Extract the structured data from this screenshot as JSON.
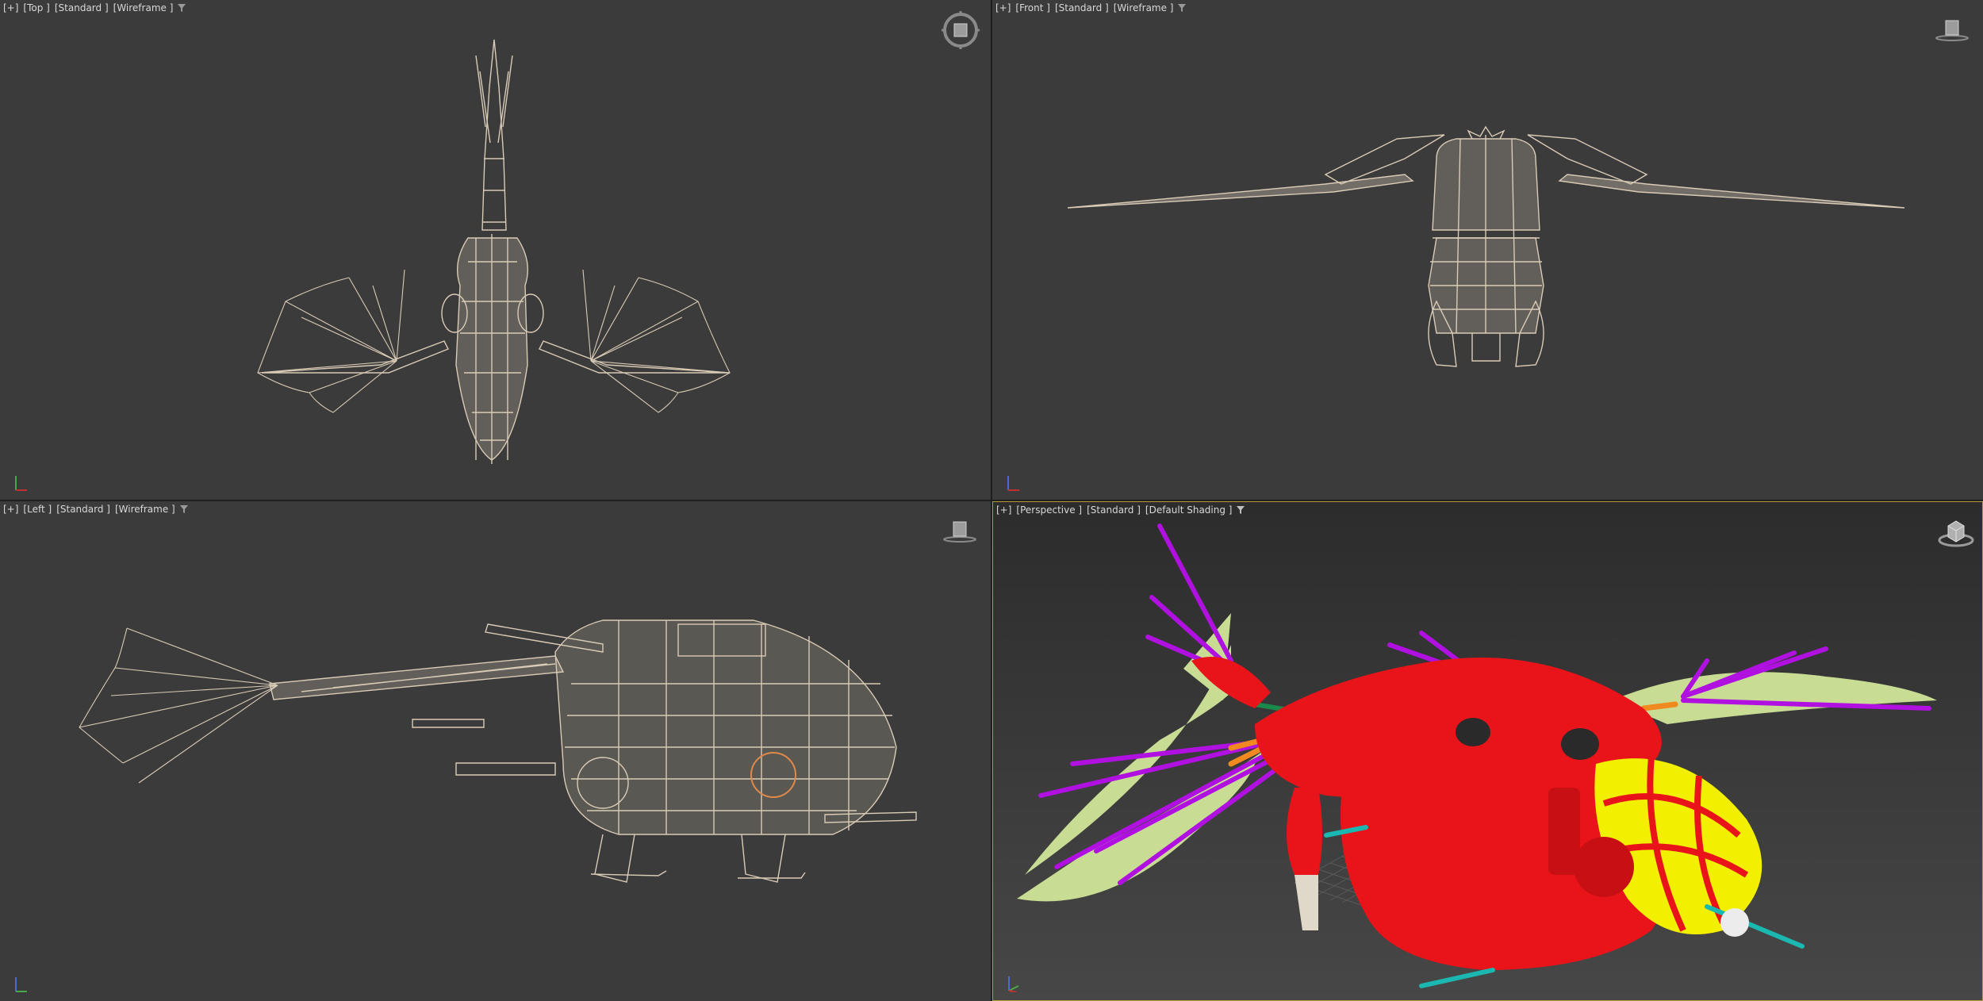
{
  "viewports": [
    {
      "id": "top",
      "menu": "[+]",
      "view": "[Top ]",
      "style": "[Standard ]",
      "shading": "[Wireframe ]"
    },
    {
      "id": "front",
      "menu": "[+]",
      "view": "[Front ]",
      "style": "[Standard ]",
      "shading": "[Wireframe ]"
    },
    {
      "id": "left",
      "menu": "[+]",
      "view": "[Left ]",
      "style": "[Standard ]",
      "shading": "[Wireframe ]"
    },
    {
      "id": "perspective",
      "menu": "[+]",
      "view": "[Perspective ]",
      "style": "[Standard ]",
      "shading": "[Default Shading ]"
    }
  ],
  "colors": {
    "viewport_bg": "#3b3b3b",
    "wireframe": "#d9cbb6",
    "model_red": "#e8141a",
    "wing_membrane": "#c8dc94",
    "wing_ribs": "#b010e0",
    "cockpit_yellow": "#f2f000",
    "active_border": "#b89a3a"
  },
  "icons": [
    "filter-icon",
    "viewcube-icon",
    "axis-tripod-icon"
  ]
}
